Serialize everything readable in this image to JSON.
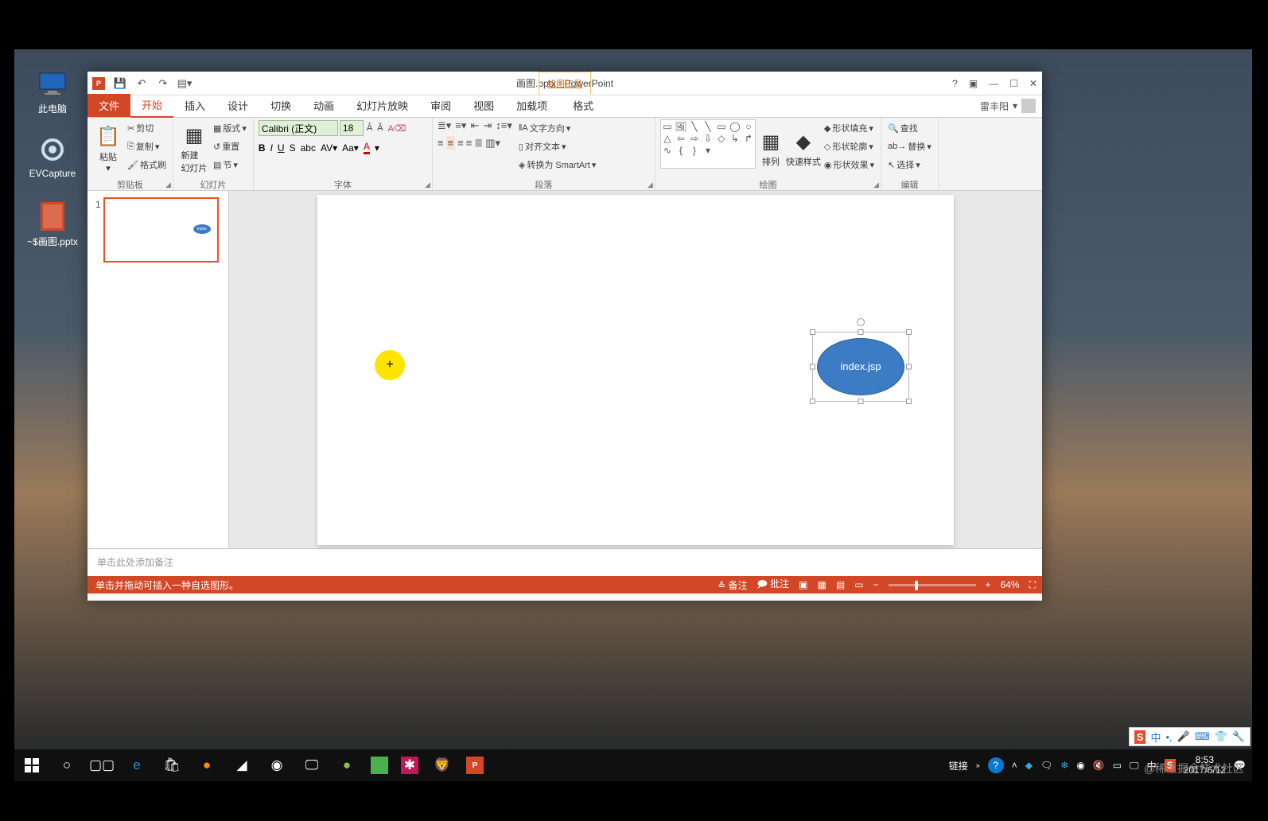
{
  "desktop": {
    "icons": [
      "此电脑",
      "EVCapture",
      "~$画图.pptx"
    ]
  },
  "window": {
    "title_file": "画图.pptx",
    "title_app": "PowerPoint",
    "context_tab_group": "绘图工具",
    "context_tab": "格式",
    "user": "雷丰阳",
    "tabs": {
      "file": "文件",
      "home": "开始",
      "insert": "插入",
      "design": "设计",
      "transition": "切换",
      "animation": "动画",
      "slideshow": "幻灯片放映",
      "review": "审阅",
      "view": "视图",
      "addins": "加载项"
    }
  },
  "ribbon": {
    "clipboard": {
      "paste": "粘贴",
      "cut": "剪切",
      "copy": "复制",
      "painter": "格式刷",
      "label": "剪贴板"
    },
    "slides": {
      "newslide": "新建\n幻灯片",
      "layout": "版式",
      "reset": "重置",
      "section": "节",
      "label": "幻灯片"
    },
    "font": {
      "family": "Calibri (正文)",
      "size": "18",
      "label": "字体"
    },
    "paragraph": {
      "textdir": "文字方向",
      "align": "对齐文本",
      "smartart": "转换为 SmartArt",
      "label": "段落"
    },
    "drawing": {
      "arrange": "排列",
      "quickstyles": "快速样式",
      "fill": "形状填充",
      "outline": "形状轮廓",
      "effects": "形状效果",
      "label": "绘图"
    },
    "editing": {
      "find": "查找",
      "replace": "替换",
      "select": "选择",
      "label": "编辑"
    }
  },
  "slide": {
    "number": "1",
    "shape_text": "index.jsp"
  },
  "notes_placeholder": "单击此处添加备注",
  "status": {
    "left": "单击并拖动可插入一种自选图形。",
    "notes": "备注",
    "comments": "批注",
    "zoom": "64%"
  },
  "ime": {
    "lang": "中"
  },
  "taskbar": {
    "link": "链接",
    "ime": "中",
    "time": "8:53",
    "date": "2017/6/12"
  },
  "watermark": "@稀土掘金技术社区"
}
